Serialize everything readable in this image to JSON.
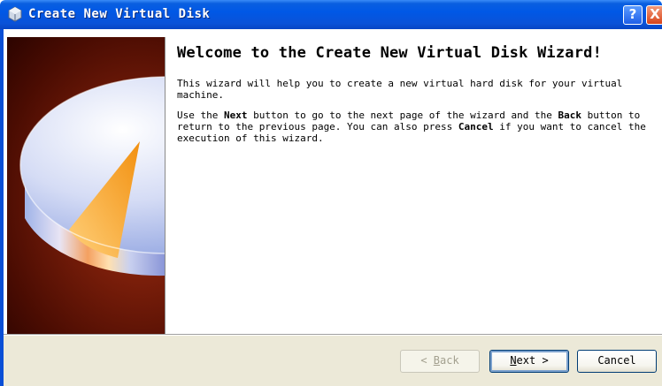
{
  "window": {
    "title": "Create New Virtual Disk",
    "help_glyph": "?",
    "close_glyph": "X",
    "icon": "virtual-disk-icon"
  },
  "banner": {
    "icon": "pie-disk-illustration"
  },
  "content": {
    "heading": "Welcome to the Create New Virtual Disk Wizard!",
    "para1": "This wizard will help you to create a new virtual hard disk for your virtual machine.",
    "para2": {
      "t1": "Use the ",
      "next": "Next",
      "t2": " button to go to the next page of the wizard and the ",
      "back": "Back",
      "t3": " button to return to the previous page. You can also press ",
      "cancel": "Cancel",
      "t4": " if you want to cancel the execution of this wizard."
    }
  },
  "buttons": {
    "back_prefix": "< ",
    "back_mnemonic": "B",
    "back_rest": "ack",
    "next_mnemonic": "N",
    "next_rest": "ext",
    "next_suffix": " >",
    "cancel": "Cancel"
  },
  "colors": {
    "title_bar": "#0058e6",
    "banner_bg": "#7a1e0a",
    "dialog_face": "#ece9d8"
  }
}
